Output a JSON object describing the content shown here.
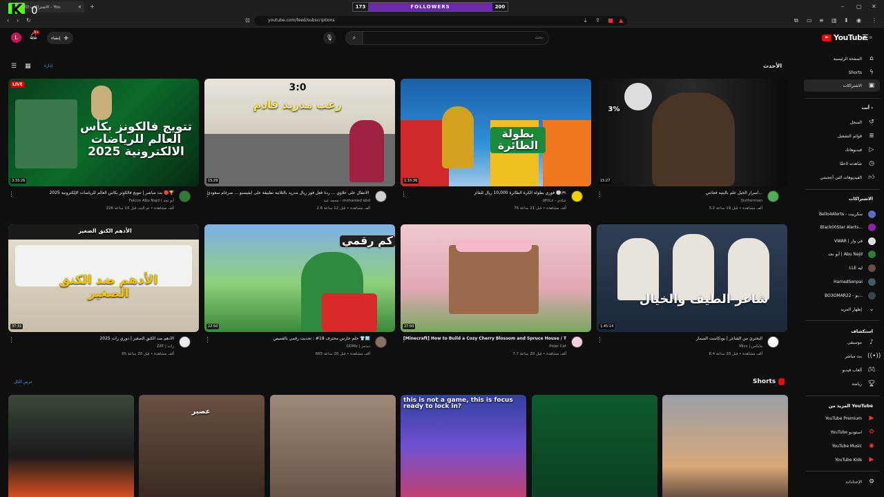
{
  "overlay": {
    "kick_letter": "K",
    "kick_count": "0",
    "followers_left": "173",
    "followers_label": "FOLLOWERS",
    "followers_right": "200"
  },
  "browser": {
    "tab_title": "(140) الاشتراكات - You",
    "url": "youtube.com/feed/subscriptions"
  },
  "header": {
    "search_placeholder": "بحث",
    "create_label": "إنشاء",
    "avatar_letter": "L",
    "notif_count": "9+",
    "logo_text": "YouTube",
    "logo_region": "SA"
  },
  "feed": {
    "title": "الأحدث",
    "view_link": "إدارة",
    "show_all": "عرض الكل"
  },
  "videos": [
    {
      "title": "بث مباشر | تتويج فالكونز بكأس العالم للرياضات الإلكترونية 2025 🔴🏆",
      "channel": "Falcon Abu Najd | أبو نجد",
      "meta": "226 ألف مشاهدة • تم البث قبل 14 ساعة",
      "duration": "3:33:26",
      "live": "LIVE",
      "thumb_text": "تتويج فالكونز بكأس العالم للرياضات الالكترونية 2025"
    },
    {
      "title": "ليلة الانتقال على علاوي ... ردة فعل فوز ريال مدريد بالثلاثية تطبيقة على ايفيسبو ... ضرغام سعودي",
      "channel": "محمد عبد - mohamed abd",
      "meta": "2.6 ألف مشاهدة • قبل 12 ساعة",
      "duration": "15:29",
      "thumb_text": "رعب مدريد قادم",
      "score": "3:0"
    },
    {
      "title": "فوري بطولة الكرة الطائرة 10,000 ريال للفائز 🏐🎮",
      "channel": "oPiiLz - عبادي",
      "meta": "76 ألف مشاهدة • قبل 21 ساعة",
      "duration": "1:10:36",
      "thumb_text": "بطولة الطائرة"
    },
    {
      "title": "أسرار الجيل علّم باليتيه فجأتني...",
      "channel": "Slytherman",
      "meta": "3.2 ألف مشاهدة • قبل 19 ساعة",
      "duration": "15:27",
      "thumb_text": "3%"
    },
    {
      "title": "الأدهم ضد الكنق الصغير | دوري زات 2025",
      "channel": "ZAT | زات",
      "meta": "65 ألف مشاهدة • قبل 20 ساعة",
      "duration": "37:31",
      "thumb_text": "الأدهم ضد الكنق الصغير",
      "thumb_top": "الأدهم  الكنق الصغير"
    },
    {
      "title": "حلم حارس محترف 18# : تحديت رقمي بالقميص 👕🔟",
      "channel": "DDMz | ديدمز",
      "meta": "665 ألف مشاهدة • قبل 20 ساعة",
      "duration": "22:50",
      "thumb_text": "كم رقمي"
    },
    {
      "title": "[Minecraft] How to Build a Cozy Cherry Blossom and Spruce House / Tutorial",
      "channel": "Polar Cat",
      "meta": "7.7 ألف مشاهدة • قبل 20 ساعة",
      "duration": "27:50",
      "thumb_text": ""
    },
    {
      "title": "البحتري من الشاعر | بودكاست السمار",
      "channel": "Mics | مايكس",
      "meta": "8.4 ألف مشاهدة • قبل 20 ساعة",
      "duration": "1:45:14",
      "thumb_text": "شاعر الطيف والخيال"
    }
  ],
  "shorts": {
    "title": "Shorts",
    "items": [
      {
        "text": ""
      },
      {
        "text": "عصير"
      },
      {
        "text": ""
      },
      {
        "text": "this is not a game, this is focus ready to lock in?"
      },
      {
        "text": ""
      },
      {
        "text": ""
      }
    ]
  },
  "sidebar": {
    "main": [
      {
        "label": "الصفحة الرئيسية",
        "icon": "home-icon"
      },
      {
        "label": "Shorts",
        "icon": "shorts-icon"
      },
      {
        "label": "الاشتراكات",
        "icon": "subscriptions-icon"
      }
    ],
    "you_head": "أنت",
    "you": [
      {
        "label": "السجل",
        "icon": "history-icon"
      },
      {
        "label": "قوائم التشغيل",
        "icon": "playlist-icon"
      },
      {
        "label": "فيديوهاتك",
        "icon": "your-videos-icon"
      },
      {
        "label": "شاهدته لاحقًا",
        "icon": "watch-later-icon"
      },
      {
        "label": "الفيديوهات التي أعجبتني",
        "icon": "like-icon"
      }
    ],
    "subs_head": "الاشتراكات",
    "subs": [
      {
        "label": "Bello4Alerts - سكريبت",
        "color": "#5c6bc0"
      },
      {
        "label": "Black00Star Alerts...",
        "color": "#8e24aa"
      },
      {
        "label": "VWAR | في وار",
        "color": "#e0e0e0"
      },
      {
        "label": "أبو نجد | Abu Najd",
        "color": "#2e7d32"
      },
      {
        "label": "LLE ليه",
        "color": "#6d4c41"
      },
      {
        "label": "HamadSenpai",
        "color": "#455a64"
      },
      {
        "label": "BO3OMAR22 - بو...",
        "color": "#37474f"
      }
    ],
    "show_more": "إظهار المزيد",
    "explore_head": "استكشاف",
    "explore": [
      {
        "label": "موسيقى",
        "icon": "music-icon"
      },
      {
        "label": "بث مباشر",
        "icon": "live-icon"
      },
      {
        "label": "ألعاب فيديو",
        "icon": "gaming-icon"
      },
      {
        "label": "رياضة",
        "icon": "trophy-icon"
      }
    ],
    "more_head": "المزيد من YouTube",
    "more": [
      {
        "label": "YouTube Premium"
      },
      {
        "label": "YouTube استوديو"
      },
      {
        "label": "YouTube Music"
      },
      {
        "label": "YouTube Kids"
      }
    ],
    "settings": "الإعدادات"
  }
}
